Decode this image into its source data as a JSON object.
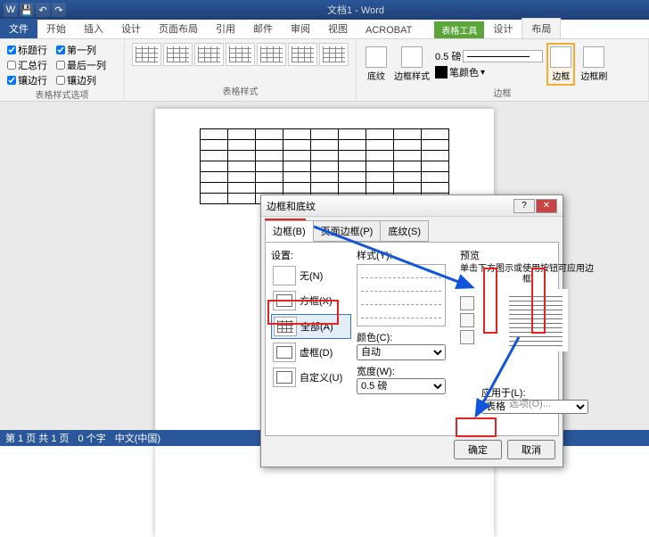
{
  "titlebar": {
    "doc_title": "文档1 - Word"
  },
  "ribbon_tabs": {
    "file": "文件",
    "home": "开始",
    "insert": "插入",
    "design": "设计",
    "page_layout": "页面布局",
    "references": "引用",
    "mailings": "邮件",
    "review": "审阅",
    "view": "视图",
    "acrobat": "ACROBAT",
    "tools_label": "表格工具",
    "tbl_design": "设计",
    "tbl_layout": "布局"
  },
  "ribbon": {
    "checks": {
      "header_row": "标题行",
      "first_col": "第一列",
      "total_row": "汇总行",
      "last_col": "最后一列",
      "banded_row": "镶边行",
      "banded_col": "镶边列"
    },
    "group1": "表格样式选项",
    "group2": "表格样式",
    "group3": "边框",
    "shading": "底纹",
    "border_styles": "边框样式",
    "pt_value": "0.5 磅",
    "pen_color": "笔颜色",
    "borders": "边框",
    "border_painter": "边框刷"
  },
  "statusbar": {
    "page": "第 1 页  共 1 页",
    "words": "0 个字",
    "lang": "中文(中国)"
  },
  "dialog": {
    "title": "边框和底纹",
    "tabs": {
      "borders": "边框(B)",
      "page_borders": "页面边框(P)",
      "shading": "底纹(S)"
    },
    "setting": "设置:",
    "presets": {
      "none": "无(N)",
      "box": "方框(X)",
      "all": "全部(A)",
      "grid": "虚框(D)",
      "custom": "自定义(U)"
    },
    "style": "样式(Y):",
    "color": "颜色(C):",
    "color_auto": "自动",
    "width": "宽度(W):",
    "width_val": "0.5 磅",
    "preview": "预览",
    "preview_hint": "单击下方图示或使用按钮可应用边框",
    "apply_to": "应用于(L):",
    "apply_table": "表格",
    "options": "选项(O)...",
    "ok": "确定",
    "cancel": "取消"
  }
}
